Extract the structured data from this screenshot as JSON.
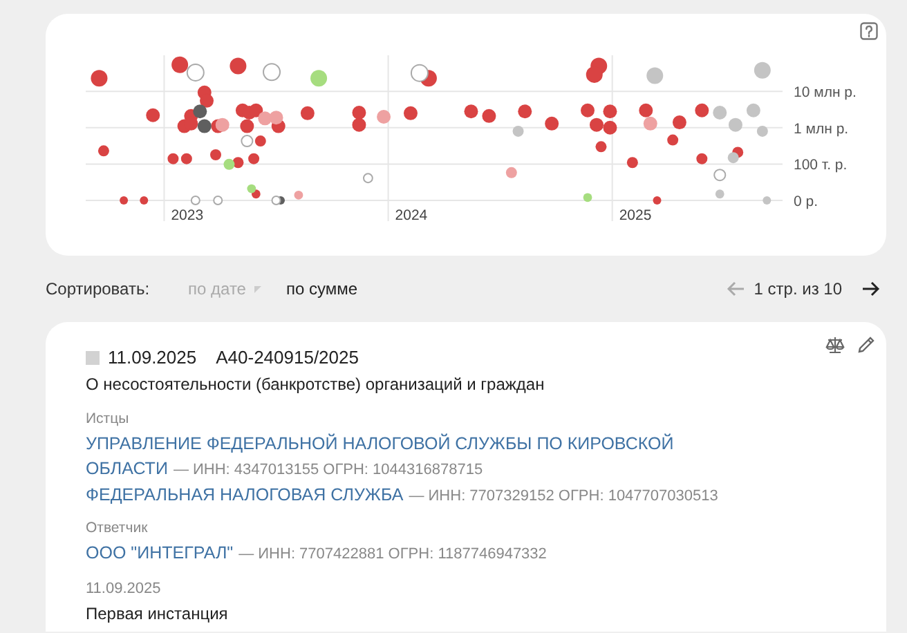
{
  "chart": {
    "x_labels": [
      "2023",
      "2024",
      "2025"
    ],
    "y_labels": [
      "10 млн р.",
      "1 млн р.",
      "100 т. р.",
      "0 р."
    ]
  },
  "sort": {
    "label": "Сортировать:",
    "options": [
      {
        "label": "по дате",
        "selected": false
      },
      {
        "label": "по сумме",
        "selected": true
      }
    ]
  },
  "pager": {
    "text": "1 стр. из 10",
    "prev_disabled": true
  },
  "case": {
    "date": "11.09.2025",
    "number": "А40-240915/2025",
    "subject": "О несостоятельности (банкротстве) организаций и граждан",
    "plaintiffs_label": "Истцы",
    "plaintiffs": [
      {
        "name": "УПРАВЛЕНИЕ ФЕДЕРАЛЬНОЙ НАЛОГОВОЙ СЛУЖБЫ ПО КИРОВСКОЙ ОБЛАСТИ",
        "details": "— ИНН: 4347013155 ОГРН: 1044316878715"
      },
      {
        "name": "ФЕДЕРАЛЬНАЯ НАЛОГОВАЯ СЛУЖБА",
        "details": "— ИНН: 7707329152 ОГРН: 1047707030513"
      }
    ],
    "defendants_label": "Ответчик",
    "defendants": [
      {
        "name": "ООО \"ИНТЕГРАЛ\"",
        "details": "— ИНН: 7707422881 ОГРН: 1187746947332"
      }
    ],
    "stage_date": "11.09.2025",
    "stage": "Первая инстанция"
  }
}
